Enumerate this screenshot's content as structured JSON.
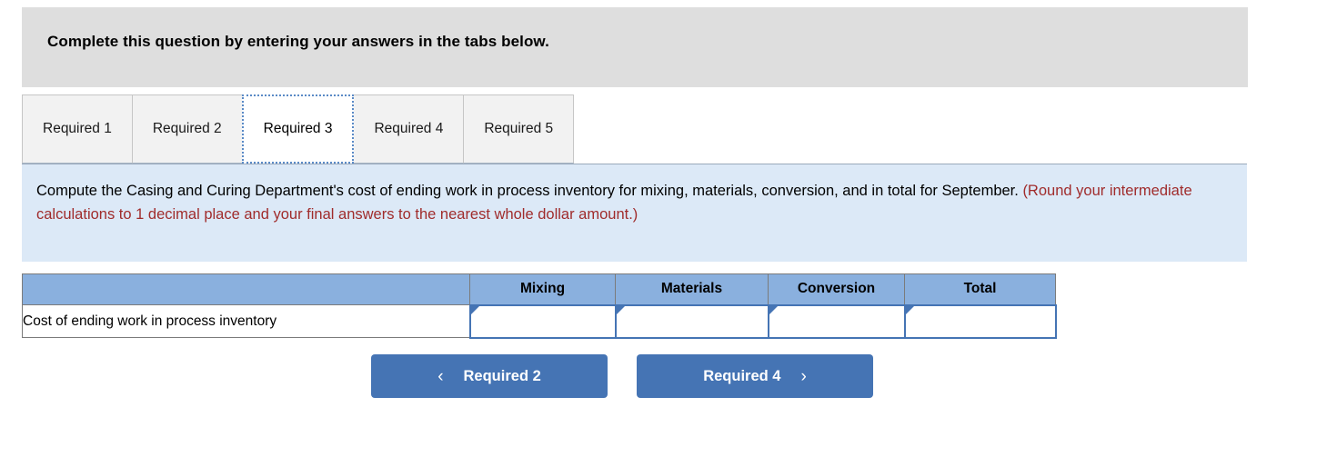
{
  "banner": {
    "title": "Complete this question by entering your answers in the tabs below."
  },
  "tabs": [
    {
      "label": "Required 1",
      "active": false
    },
    {
      "label": "Required 2",
      "active": false
    },
    {
      "label": "Required 3",
      "active": true
    },
    {
      "label": "Required 4",
      "active": false
    },
    {
      "label": "Required 5",
      "active": false
    }
  ],
  "instruction": {
    "black_text": "Compute the Casing and Curing Department's cost of ending work in process inventory for mixing, materials, conversion, and in total for September. ",
    "red_text": "(Round your intermediate calculations to 1 decimal place and your final answers to the nearest whole dollar amount.)"
  },
  "table": {
    "headers": [
      "",
      "Mixing",
      "Materials",
      "Conversion",
      "Total"
    ],
    "rows": [
      {
        "label": "Cost of ending work in process inventory",
        "mixing": "",
        "materials": "",
        "conversion": "",
        "total": ""
      }
    ]
  },
  "nav": {
    "prev_label": "Required 2",
    "next_label": "Required 4",
    "prev_icon": "chevron-left-icon",
    "next_icon": "chevron-right-icon",
    "chevron_left": "‹",
    "chevron_right": "›"
  },
  "colors": {
    "banner_bg": "#dedede",
    "instruction_bg": "#dce9f7",
    "accent_blue": "#4574b4",
    "header_blue": "#8ab0de",
    "red_text": "#a02c2c",
    "tab_inactive_bg": "#f2f2f2"
  }
}
